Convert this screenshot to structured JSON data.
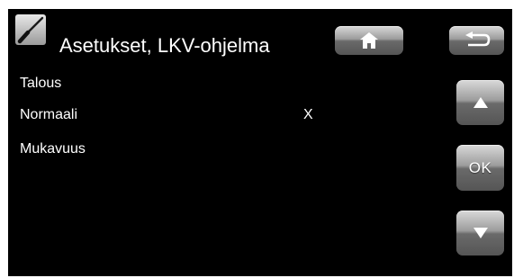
{
  "header": {
    "title": "Asetukset, LKV-ohjelma",
    "app_icon": "screwdriver-icon",
    "home_icon": "home-icon",
    "back_icon": "back-arrow-icon"
  },
  "menu": {
    "items": [
      {
        "label": "Talous",
        "mark": ""
      },
      {
        "label": "Normaali",
        "mark": "X"
      },
      {
        "label": "Mukavuus",
        "mark": ""
      }
    ]
  },
  "nav": {
    "up_icon": "arrow-up-icon",
    "ok_label": "OK",
    "down_icon": "arrow-down-icon"
  },
  "colors": {
    "background": "#000000",
    "text": "#ffffff",
    "button": "#8c8c8c",
    "frame": "#ffffff"
  }
}
